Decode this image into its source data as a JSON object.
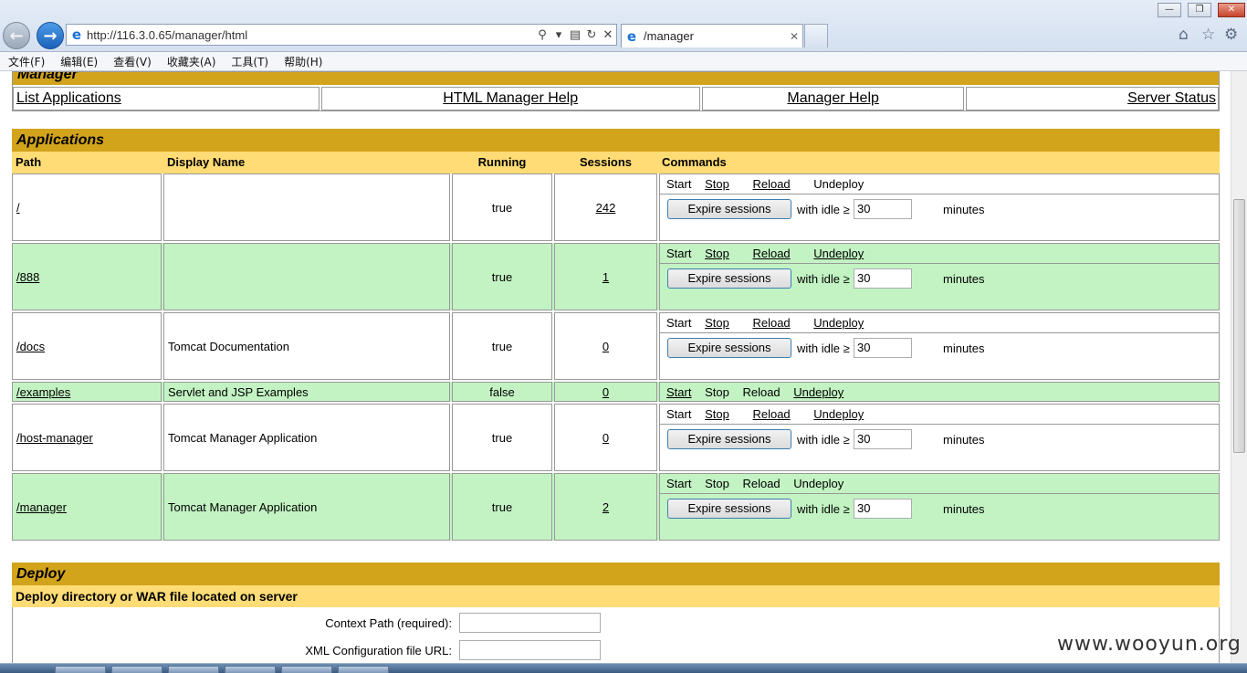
{
  "browser": {
    "url": "http://116.3.0.65/manager/html",
    "tab_title": "/manager",
    "menu": [
      "文件(F)",
      "编辑(E)",
      "查看(V)",
      "收藏夹(A)",
      "工具(T)",
      "帮助(H)"
    ]
  },
  "manager": {
    "title": "Manager",
    "links": [
      "List Applications",
      "HTML Manager Help",
      "Manager Help",
      "Server Status"
    ]
  },
  "applications": {
    "title": "Applications",
    "headers": [
      "Path",
      "Display Name",
      "Running",
      "Sessions",
      "Commands"
    ],
    "expire_label": "Expire sessions",
    "idle_label": "with idle ≥",
    "idle_value": "30",
    "minutes_label": "minutes",
    "commands": [
      "Start",
      "Stop",
      "Reload",
      "Undeploy"
    ],
    "rows": [
      {
        "path": "/",
        "name": "",
        "running": "true",
        "sessions": "242"
      },
      {
        "path": "/888",
        "name": "",
        "running": "true",
        "sessions": "1"
      },
      {
        "path": "/docs",
        "name": "Tomcat Documentation",
        "running": "true",
        "sessions": "0"
      },
      {
        "path": "/examples",
        "name": "Servlet and JSP Examples",
        "running": "false",
        "sessions": "0"
      },
      {
        "path": "/host-manager",
        "name": "Tomcat Manager Application",
        "running": "true",
        "sessions": "0"
      },
      {
        "path": "/manager",
        "name": "Tomcat Manager Application",
        "running": "true",
        "sessions": "2"
      }
    ]
  },
  "deploy": {
    "title": "Deploy",
    "subtitle": "Deploy directory or WAR file located on server",
    "context_label": "Context Path (required):",
    "xml_label": "XML Configuration file URL:"
  },
  "watermark": "www.wooyun.org",
  "icons": [
    "back-arrow-icon",
    "forward-arrow-icon",
    "ie-logo-icon",
    "search-icon",
    "refresh-icon",
    "close-icon",
    "home-icon",
    "star-icon",
    "gear-icon"
  ],
  "colors": {
    "title_bar": "#d2a41c",
    "header": "#ffdc75",
    "row_alt": "#c3f3c3"
  }
}
